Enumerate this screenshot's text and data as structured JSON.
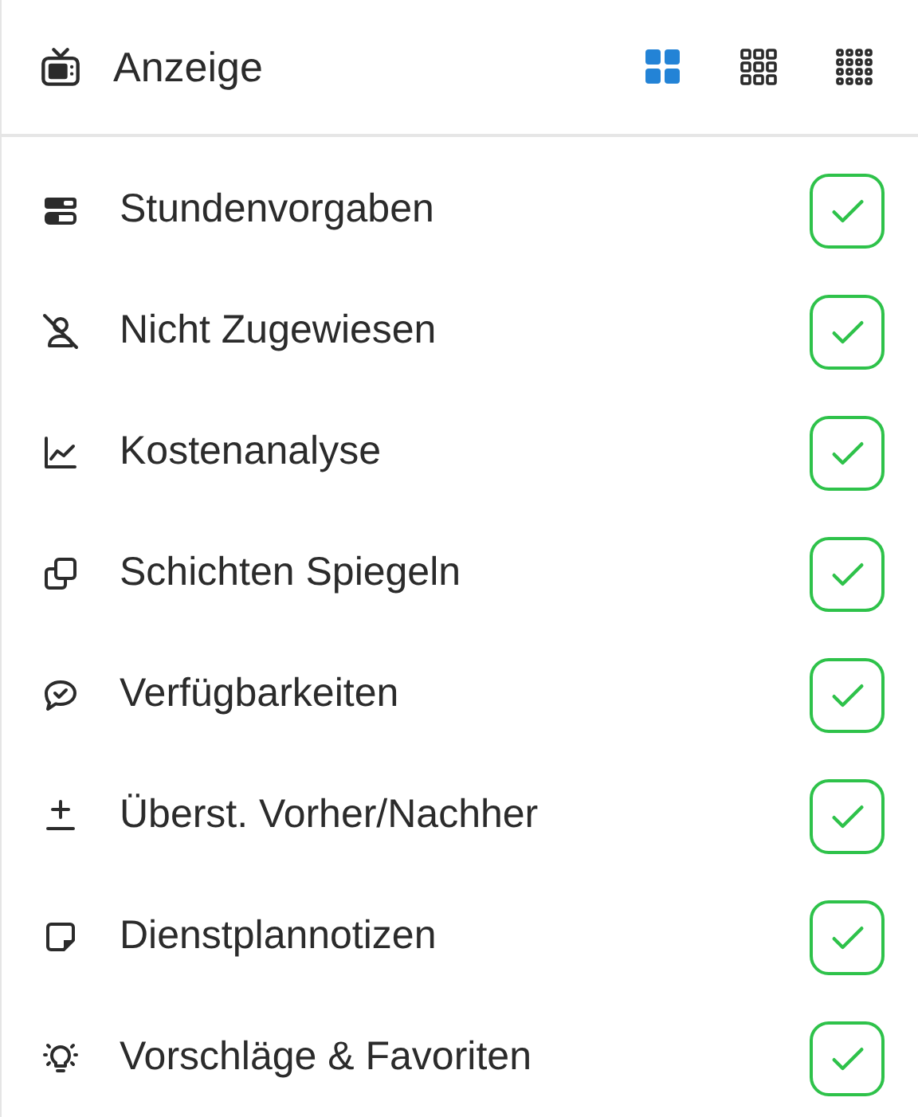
{
  "header": {
    "title": "Anzeige",
    "views": [
      {
        "kind": "large",
        "selected": true
      },
      {
        "kind": "medium",
        "selected": false
      },
      {
        "kind": "small",
        "selected": false
      }
    ]
  },
  "items": [
    {
      "label": "Stundenvorgaben",
      "checked": true
    },
    {
      "label": "Nicht Zugewiesen",
      "checked": true
    },
    {
      "label": "Kostenanalyse",
      "checked": true
    },
    {
      "label": "Schichten Spiegeln",
      "checked": true
    },
    {
      "label": "Verfügbarkeiten",
      "checked": true
    },
    {
      "label": "Überst. Vorher/Nachher",
      "checked": true
    },
    {
      "label": "Dienstplannotizen",
      "checked": true
    },
    {
      "label": "Vorschläge & Favoriten",
      "checked": true
    }
  ]
}
